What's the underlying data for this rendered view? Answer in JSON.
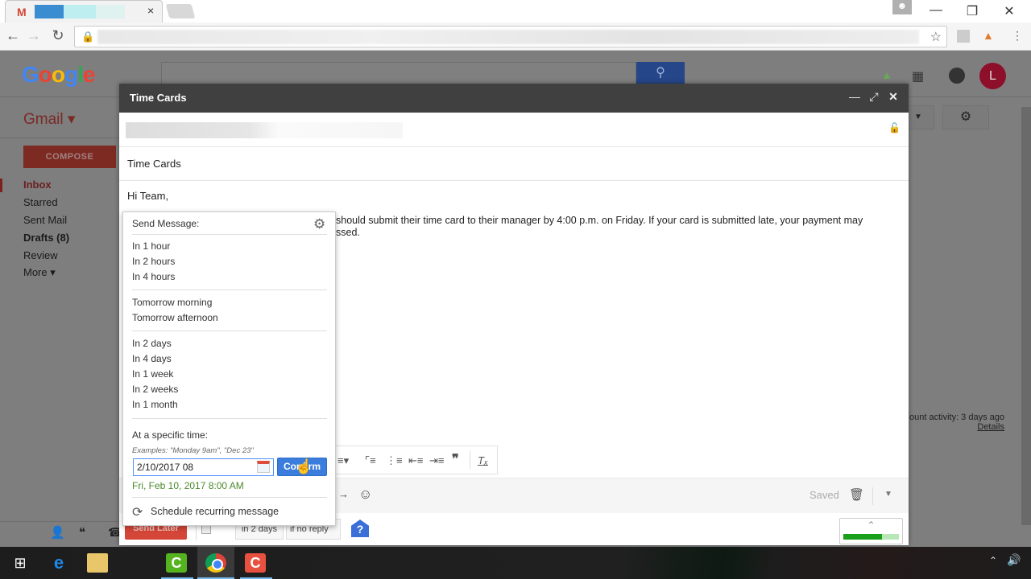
{
  "browser": {
    "tab_favicon": "M",
    "tab_close": "×",
    "window_controls": {
      "minimize": "—",
      "restore": "❐",
      "close": "✕"
    },
    "profile_icon": "person-icon",
    "nav": {
      "back": "←",
      "forward": "→",
      "reload": "↻"
    },
    "bookmark_star": "☆",
    "extensions": [
      "pdf-extension-icon",
      "boomerang-extension-icon",
      "menu-icon"
    ]
  },
  "gmail": {
    "logo": {
      "letters": [
        "G",
        "o",
        "o",
        "g",
        "l",
        "e"
      ],
      "colors": [
        "#4285f4",
        "#ea4335",
        "#fbbc05",
        "#4285f4",
        "#34a853",
        "#ea4335"
      ]
    },
    "search_button_icon": "⚲",
    "avatar_letter": "L",
    "app_label": "Gmail ▾",
    "compose_label": "COMPOSE",
    "nav_items": [
      {
        "label": "Inbox",
        "active": true
      },
      {
        "label": "Starred"
      },
      {
        "label": "Sent Mail"
      },
      {
        "label": "Drafts (8)",
        "bold": true
      },
      {
        "label": "Review"
      },
      {
        "label": "More ▾"
      }
    ],
    "account_activity": "ount activity: 3 days ago",
    "details_link": "Details"
  },
  "compose": {
    "window_title": "Time Cards",
    "subject": "Time Cards",
    "greeting": "Hi Team,",
    "body_line1": "should submit their time card to their manager by 4:00 p.m. on Friday. If your card is submitted late, your payment may",
    "body_line2": "ssed.",
    "saved_label": "Saved",
    "send_later_label": "Send Later",
    "return_in": "in 2 days",
    "return_condition": "if no reply",
    "help_icon": "?",
    "progress_fraction": 0.7
  },
  "send_later_popup": {
    "title": "Send Message:",
    "group1": [
      "In 1 hour",
      "In 2 hours",
      "In 4 hours"
    ],
    "group2": [
      "Tomorrow morning",
      "Tomorrow afternoon"
    ],
    "group3": [
      "In 2 days",
      "In 4 days",
      "In 1 week",
      "In 2 weeks",
      "In 1 month"
    ],
    "specific_time_label": "At a specific time:",
    "examples": "Examples: \"Monday 9am\", \"Dec 23\"",
    "date_input_value": "2/10/2017 08",
    "confirm_label": "Confirm",
    "parsed_date": "Fri, Feb 10, 2017 8:00 AM",
    "recurring_label": "Schedule recurring message"
  },
  "colors": {
    "gmail_red": "#d44638",
    "confirm_blue": "#3b7ddd",
    "parsed_green": "#4b8a2a",
    "compose_header": "#404040"
  }
}
